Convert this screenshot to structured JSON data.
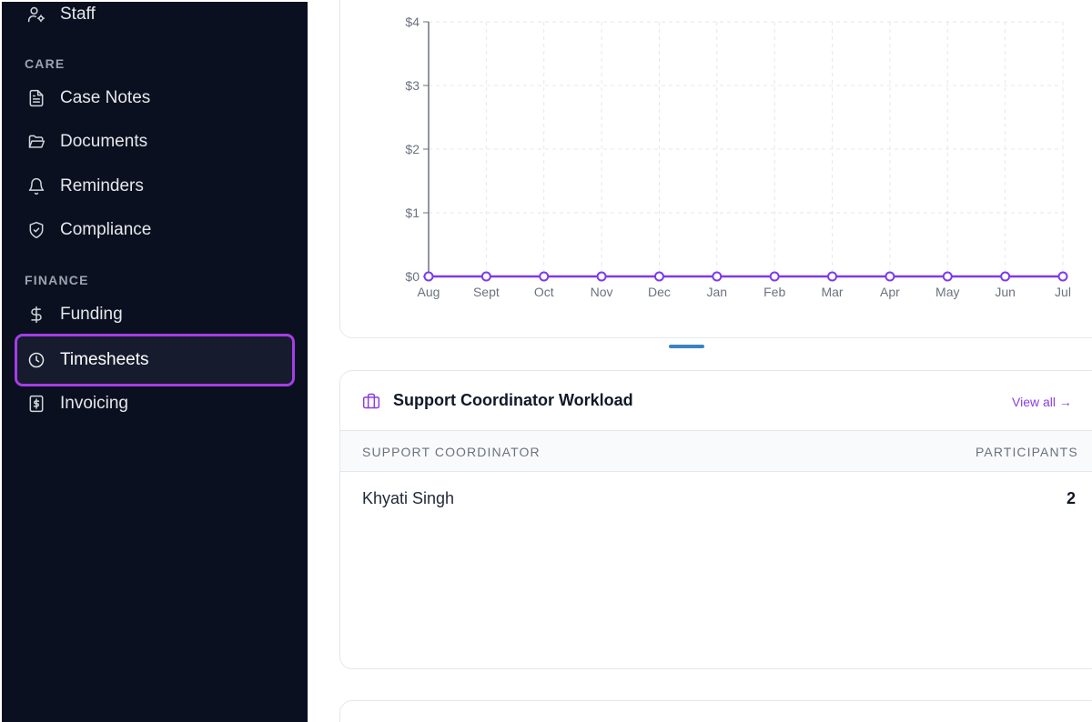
{
  "sidebar": {
    "items": [
      {
        "label": "Staff"
      },
      {
        "label": "Case Notes"
      },
      {
        "label": "Documents"
      },
      {
        "label": "Reminders"
      },
      {
        "label": "Compliance"
      },
      {
        "label": "Funding"
      },
      {
        "label": "Timesheets"
      },
      {
        "label": "Invoicing"
      }
    ],
    "sections": {
      "care": "CARE",
      "finance": "FINANCE"
    },
    "active": "Timesheets"
  },
  "chart_data": {
    "type": "line",
    "categories": [
      "Aug",
      "Sept",
      "Oct",
      "Nov",
      "Dec",
      "Jan",
      "Feb",
      "Mar",
      "Apr",
      "May",
      "Jun",
      "Jul"
    ],
    "series": [
      {
        "values": [
          0,
          0,
          0,
          0,
          0,
          0,
          0,
          0,
          0,
          0,
          0,
          0
        ]
      }
    ],
    "y_ticks": [
      "$0",
      "$1",
      "$2",
      "$3",
      "$4"
    ],
    "ylim": [
      0,
      4
    ],
    "grid": true,
    "line_color": "#7c3aed"
  },
  "workload": {
    "title": "Support Coordinator Workload",
    "view_all": "View all →",
    "columns": [
      "SUPPORT COORDINATOR",
      "PARTICIPANTS"
    ],
    "rows": [
      {
        "name": "Khyati Singh",
        "participants": "2"
      }
    ]
  },
  "colors": {
    "sidebar_bg": "#0b1020",
    "accent": "#a43ee6",
    "link": "#8b3ee0"
  }
}
